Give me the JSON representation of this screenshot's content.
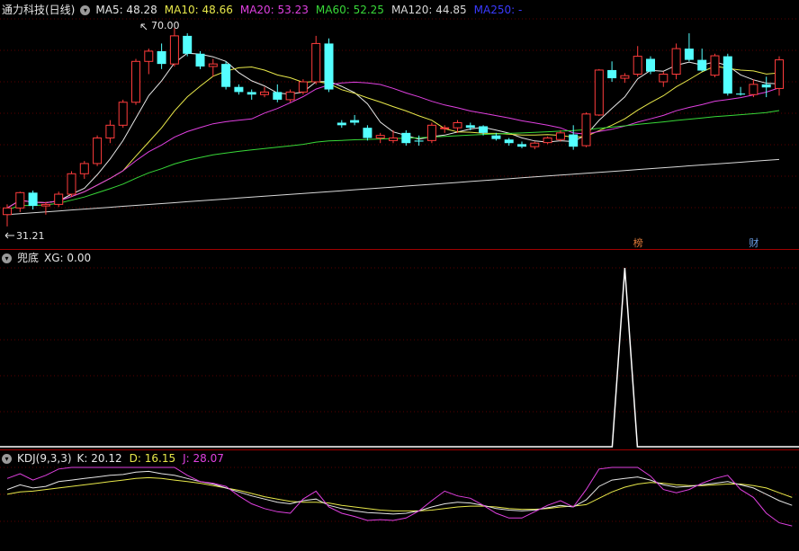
{
  "main_panel": {
    "title": "通力科技(日线)",
    "indicators": [
      {
        "label": "MA5: 48.28",
        "color": "#e6e6e6"
      },
      {
        "label": "MA10: 48.66",
        "color": "#e8e84a"
      },
      {
        "label": "MA20: 53.23",
        "color": "#e040e0"
      },
      {
        "label": "MA60: 52.25",
        "color": "#38d838"
      },
      {
        "label": "MA120: 44.85",
        "color": "#d8d8d8"
      },
      {
        "label": "MA250: -",
        "color": "#3a3aff"
      }
    ],
    "annotation_high": "70.00",
    "annotation_low": "31.21",
    "markers": [
      {
        "label": "榜",
        "bar": 49,
        "color": "#e07b3a"
      },
      {
        "label": "财",
        "bar": 58,
        "color": "#6a9fe8"
      }
    ],
    "colors": {
      "up": "#ff3c3c",
      "down": "#54ffff",
      "ma5": "#e6e6e6",
      "ma10": "#e8e84a",
      "ma20": "#e040e0",
      "ma60": "#38d838",
      "ma120": "#d8d8d8"
    }
  },
  "xg_panel": {
    "title": "兜底",
    "indicator_label": "XG: 0.00",
    "color": "#ffffff"
  },
  "kdj_panel": {
    "title": "KDJ(9,3,3)",
    "indicators": [
      {
        "label": "K: 20.12",
        "color": "#e6e6e6"
      },
      {
        "label": "D: 16.15",
        "color": "#e8e84a"
      },
      {
        "label": "J: 28.07",
        "color": "#e040e0"
      }
    ]
  },
  "chart_data": {
    "type": "candlestick",
    "ylim": [
      28,
      72
    ],
    "candles": [
      [
        33.5,
        35.5,
        31.2,
        34.8
      ],
      [
        34.8,
        38,
        34,
        37.8
      ],
      [
        37.8,
        38.2,
        34.5,
        35.2
      ],
      [
        35.2,
        36,
        33.5,
        35.5
      ],
      [
        35.5,
        38,
        35,
        37.5
      ],
      [
        37.5,
        42,
        37,
        41.5
      ],
      [
        41.5,
        44,
        40.5,
        43.5
      ],
      [
        43.5,
        49,
        43,
        48.5
      ],
      [
        48.5,
        52,
        47.5,
        51
      ],
      [
        51,
        56,
        50.5,
        55.5
      ],
      [
        55.5,
        64,
        55,
        63.5
      ],
      [
        63.5,
        66,
        61,
        65.5
      ],
      [
        65.5,
        67,
        62,
        63
      ],
      [
        63,
        70,
        62.5,
        68.5
      ],
      [
        68.5,
        69,
        64.5,
        65
      ],
      [
        65,
        65.5,
        62,
        62.5
      ],
      [
        62.5,
        64,
        60.5,
        63
      ],
      [
        63,
        63.5,
        58,
        58.5
      ],
      [
        58.5,
        59,
        57,
        57.5
      ],
      [
        57.5,
        58,
        56,
        57
      ],
      [
        57,
        58.5,
        56.5,
        57.5
      ],
      [
        57.5,
        59,
        55.5,
        56
      ],
      [
        56,
        58,
        55.5,
        57.5
      ],
      [
        57.5,
        60,
        57,
        59.5
      ],
      [
        59.5,
        68.5,
        59,
        67
      ],
      [
        67,
        68,
        57.5,
        58
      ],
      [
        51.5,
        52,
        50.5,
        51
      ],
      [
        52,
        53,
        51,
        51.5
      ],
      [
        50.5,
        51,
        48,
        48.5
      ],
      [
        48.5,
        49.5,
        47.5,
        49
      ],
      [
        48,
        50,
        47.5,
        48.5
      ],
      [
        49.5,
        50,
        47,
        47.5
      ],
      [
        48,
        49,
        47,
        47.8
      ],
      [
        48,
        51.5,
        47.5,
        51
      ],
      [
        50.5,
        51,
        49.5,
        50.5
      ],
      [
        50.5,
        52,
        49.5,
        51.5
      ],
      [
        51,
        51.5,
        50,
        50.5
      ],
      [
        50.8,
        51,
        49,
        49.5
      ],
      [
        49,
        49.5,
        48,
        48.3
      ],
      [
        48.2,
        48.5,
        47,
        47.5
      ],
      [
        47.3,
        47.8,
        46.5,
        46.8
      ],
      [
        46.8,
        47.8,
        46.3,
        47.5
      ],
      [
        47.6,
        48.8,
        47.3,
        48.5
      ],
      [
        48.2,
        50,
        47.8,
        49.5
      ],
      [
        49.2,
        51,
        46.2,
        46.8
      ],
      [
        47,
        53.5,
        46.7,
        53.2
      ],
      [
        53,
        62,
        52.8,
        61.8
      ],
      [
        61.8,
        63.5,
        59.5,
        60.2
      ],
      [
        60.2,
        61.2,
        59.3,
        60.7
      ],
      [
        61,
        66.5,
        60.5,
        64.5
      ],
      [
        64,
        64.5,
        61,
        61.5
      ],
      [
        59.5,
        61.5,
        58.5,
        61
      ],
      [
        61,
        67,
        60,
        66
      ],
      [
        66,
        69,
        63.5,
        63.8
      ],
      [
        63.8,
        66,
        61.5,
        61.7
      ],
      [
        60.8,
        65,
        60.4,
        64.6
      ],
      [
        64.5,
        65,
        56.8,
        57.2
      ],
      [
        57.2,
        58.5,
        56.8,
        57
      ],
      [
        57,
        60,
        56.5,
        59
      ],
      [
        59,
        60.5,
        56.5,
        58.4
      ],
      [
        58.2,
        64.5,
        56.8,
        63.8
      ]
    ],
    "kdj": {
      "k": [
        72,
        78,
        74,
        76,
        82,
        84,
        86,
        88,
        90,
        91,
        94,
        95,
        92,
        90,
        86,
        82,
        79,
        74,
        69,
        64,
        60,
        56,
        54,
        58,
        60,
        52,
        48,
        45,
        43,
        42,
        41,
        42,
        45,
        50,
        54,
        56,
        55,
        52,
        48,
        46,
        45,
        46,
        49,
        52,
        50,
        59,
        76,
        84,
        86,
        88,
        84,
        78,
        75,
        76,
        78,
        80,
        82,
        78,
        74,
        66,
        58,
        52
      ],
      "d": [
        66,
        69,
        70,
        72,
        74,
        76,
        78,
        80,
        82,
        84,
        86,
        87,
        86,
        84,
        82,
        80,
        77,
        74,
        71,
        67,
        63,
        60,
        57,
        56,
        56,
        55,
        52,
        50,
        48,
        46,
        45,
        45,
        45,
        46,
        48,
        50,
        51,
        51,
        50,
        48,
        47,
        47,
        48,
        50,
        51,
        53,
        61,
        69,
        75,
        79,
        81,
        80,
        78,
        77,
        77,
        78,
        79,
        79,
        77,
        74,
        68,
        62
      ],
      "j": [
        86,
        92,
        84,
        90,
        98,
        100,
        100,
        100,
        100,
        100,
        100,
        100,
        100,
        100,
        90,
        82,
        80,
        76,
        64,
        54,
        48,
        44,
        42,
        60,
        70,
        50,
        42,
        38,
        33,
        34,
        33,
        36,
        45,
        58,
        70,
        64,
        61,
        52,
        42,
        36,
        36,
        44,
        52,
        58,
        50,
        72,
        98,
        100,
        100,
        100,
        89,
        72,
        68,
        72,
        80,
        86,
        90,
        72,
        62,
        42,
        30,
        26
      ]
    },
    "xg": {
      "spike_bar": 48,
      "spike_value": 1,
      "baseline": 0
    }
  }
}
